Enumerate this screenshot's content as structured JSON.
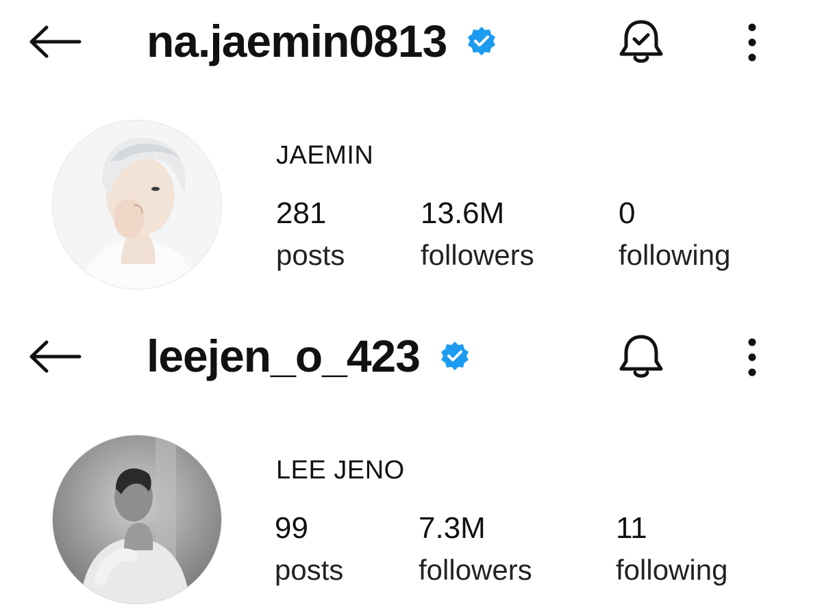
{
  "colors": {
    "verified": "#1d9bf0",
    "text": "#111111",
    "background": "#ffffff"
  },
  "profiles": [
    {
      "username": "na.jaemin0813",
      "display_name": "JAEMIN",
      "verified_icon": "verified-badge-icon",
      "notification_icon": "bell-check-icon",
      "stats": [
        {
          "value": "281",
          "label": "posts"
        },
        {
          "value": "13.6M",
          "label": "followers"
        },
        {
          "value": "0",
          "label": "following"
        }
      ]
    },
    {
      "username": "leejen_o_423",
      "display_name": "LEE JENO",
      "verified_icon": "verified-badge-icon",
      "notification_icon": "bell-icon",
      "stats": [
        {
          "value": "99",
          "label": "posts"
        },
        {
          "value": "7.3M",
          "label": "followers"
        },
        {
          "value": "11",
          "label": "following"
        }
      ]
    }
  ]
}
